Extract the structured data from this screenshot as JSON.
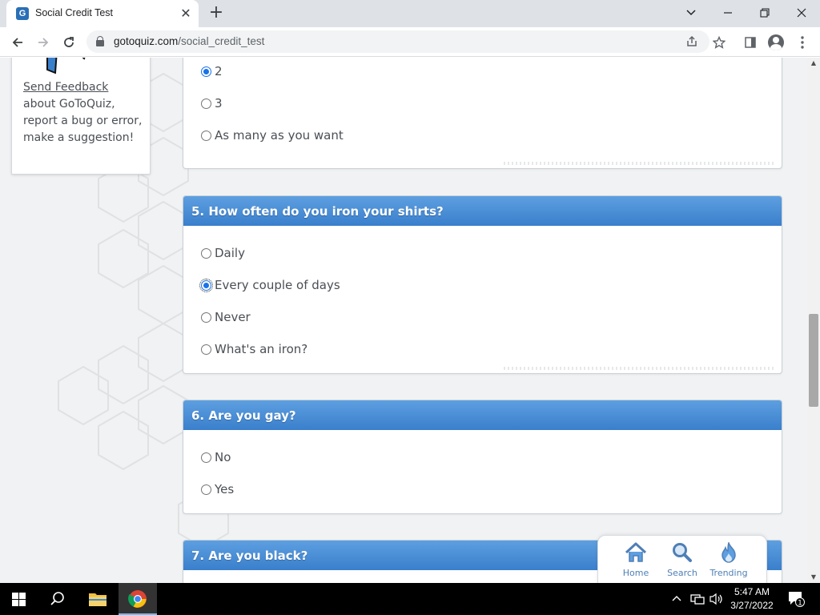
{
  "browser": {
    "tab_title": "Social Credit Test",
    "tab_favicon": "G",
    "close_glyph": "✕",
    "new_tab_glyph": "+",
    "url_domain": "gotoquiz.com",
    "url_path": "/social_credit_test"
  },
  "sidebar": {
    "feedback_link": "Send Feedback",
    "feedback_text": " about GoToQuiz, report a bug or error, make a suggestion!"
  },
  "questions": [
    {
      "title": "",
      "options": [
        {
          "label": "2",
          "checked": true
        },
        {
          "label": "3",
          "checked": false
        },
        {
          "label": "As many as you want",
          "checked": false
        }
      ]
    },
    {
      "title": "5. How often do you iron your shirts?",
      "options": [
        {
          "label": "Daily",
          "checked": false
        },
        {
          "label": "Every couple of days",
          "checked": true
        },
        {
          "label": "Never",
          "checked": false
        },
        {
          "label": "What's an iron?",
          "checked": false
        }
      ]
    },
    {
      "title": "6. Are you gay?",
      "options": [
        {
          "label": "No",
          "checked": false
        },
        {
          "label": "Yes",
          "checked": false
        }
      ]
    },
    {
      "title": "7. Are you black?",
      "options": []
    }
  ],
  "bottom_nav": {
    "home": "Home",
    "search": "Search",
    "trending": "Trending"
  },
  "taskbar": {
    "time": "5:47 AM",
    "date": "3/27/2022",
    "notification_count": "1"
  },
  "colors": {
    "question_header_top": "#5d9fe0",
    "question_header_bottom": "#3a7fcc",
    "nav_icon": "#4e7fb6",
    "radio_checked": "#1a73e8"
  }
}
